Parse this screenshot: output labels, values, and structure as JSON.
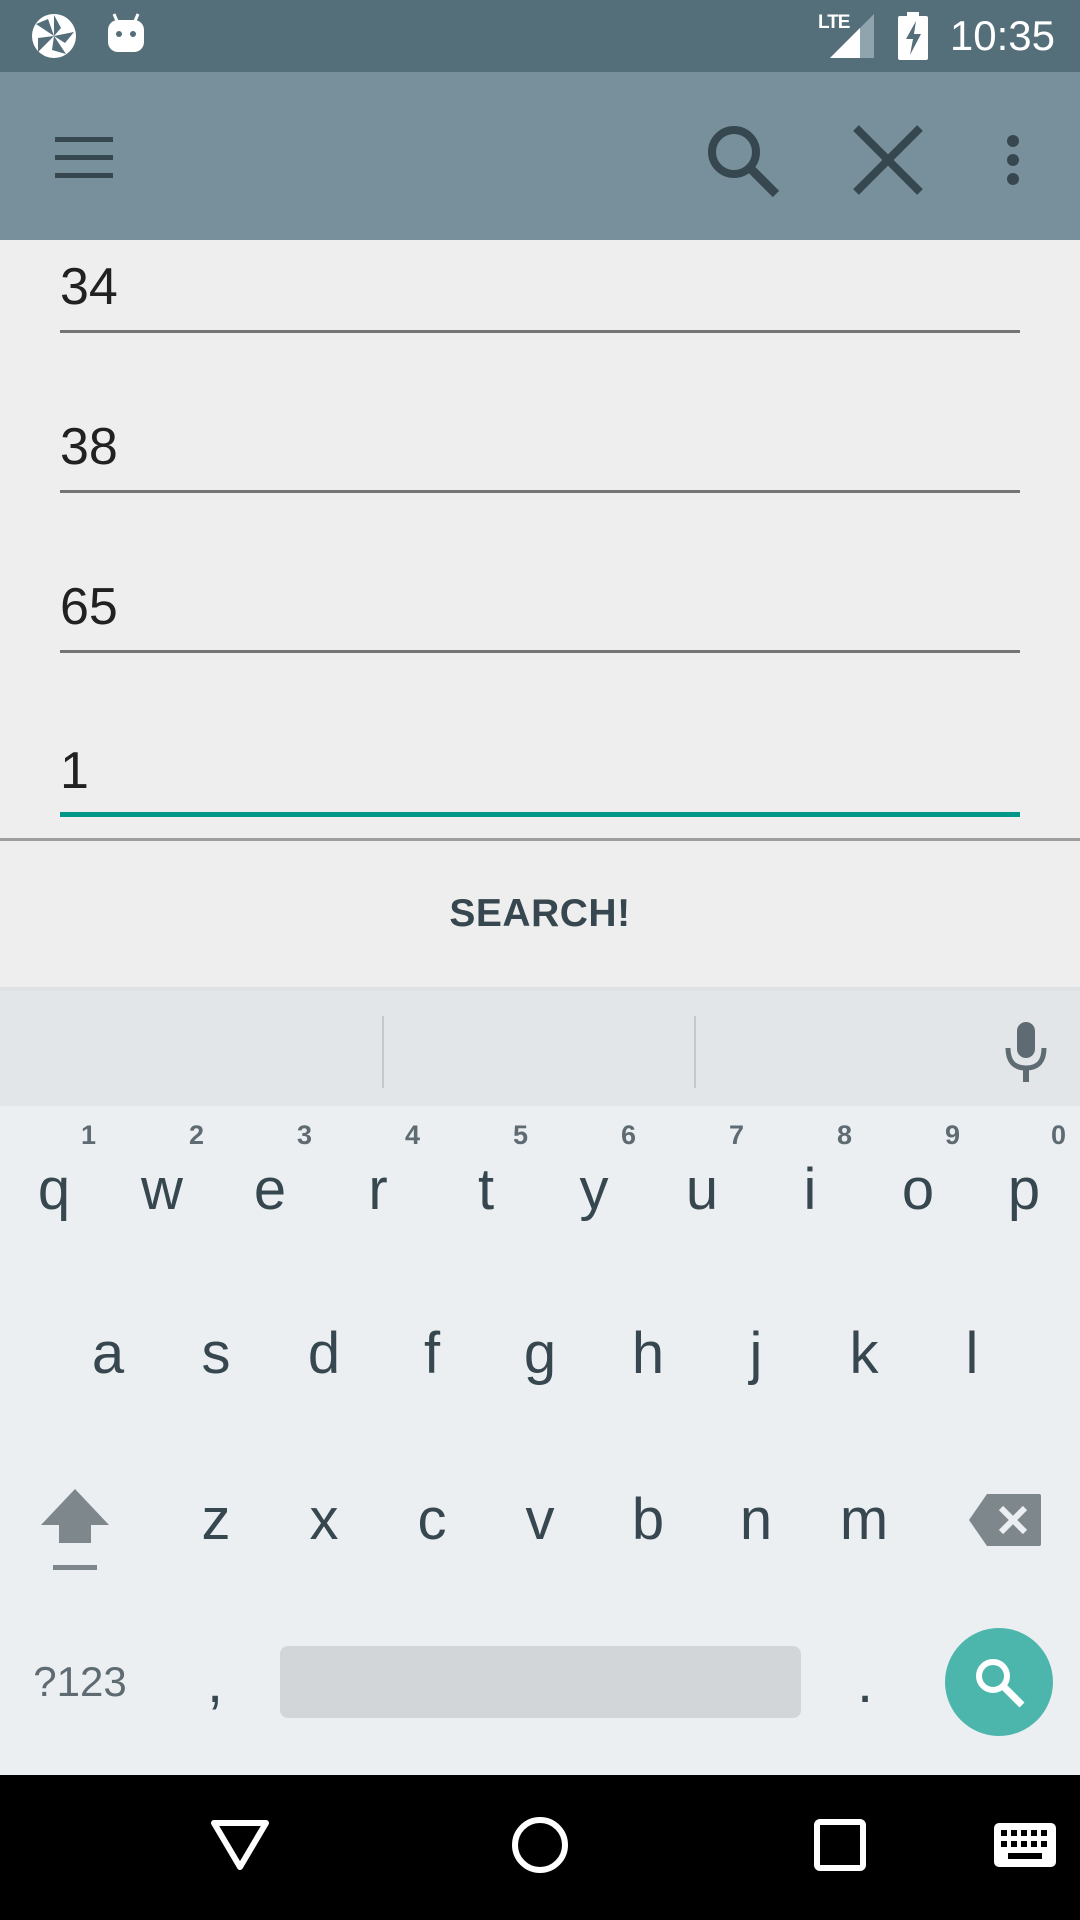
{
  "status_bar": {
    "time": "10:35",
    "network_label": "LTE",
    "icons": [
      "pinwheel-notification-icon",
      "android-notification-icon",
      "lte-signal-icon",
      "battery-charging-icon"
    ]
  },
  "toolbar": {
    "icons": [
      "menu-icon",
      "search-icon",
      "close-icon",
      "overflow-menu-icon"
    ]
  },
  "fields": [
    {
      "value": "34",
      "active": false
    },
    {
      "value": "38",
      "active": false
    },
    {
      "value": "65",
      "active": false
    },
    {
      "value": "1",
      "active": true
    }
  ],
  "search_button_label": "SEARCH!",
  "keyboard": {
    "row1": [
      {
        "letter": "q",
        "hint": "1"
      },
      {
        "letter": "w",
        "hint": "2"
      },
      {
        "letter": "e",
        "hint": "3"
      },
      {
        "letter": "r",
        "hint": "4"
      },
      {
        "letter": "t",
        "hint": "5"
      },
      {
        "letter": "y",
        "hint": "6"
      },
      {
        "letter": "u",
        "hint": "7"
      },
      {
        "letter": "i",
        "hint": "8"
      },
      {
        "letter": "o",
        "hint": "9"
      },
      {
        "letter": "p",
        "hint": "0"
      }
    ],
    "row2": [
      "a",
      "s",
      "d",
      "f",
      "g",
      "h",
      "j",
      "k",
      "l"
    ],
    "row3": [
      "z",
      "x",
      "c",
      "v",
      "b",
      "n",
      "m"
    ],
    "symbols_label": "?123",
    "comma_label": ",",
    "period_label": ".",
    "icons": [
      "microphone-icon",
      "shift-icon",
      "backspace-icon",
      "search-icon"
    ]
  },
  "nav_bar": {
    "icons": [
      "back-icon",
      "home-icon",
      "recents-icon",
      "keyboard-icon"
    ]
  },
  "colors": {
    "status_bar": "#546e7a",
    "toolbar": "#78909c",
    "accent": "#009688",
    "search_key": "#4db6ac"
  }
}
